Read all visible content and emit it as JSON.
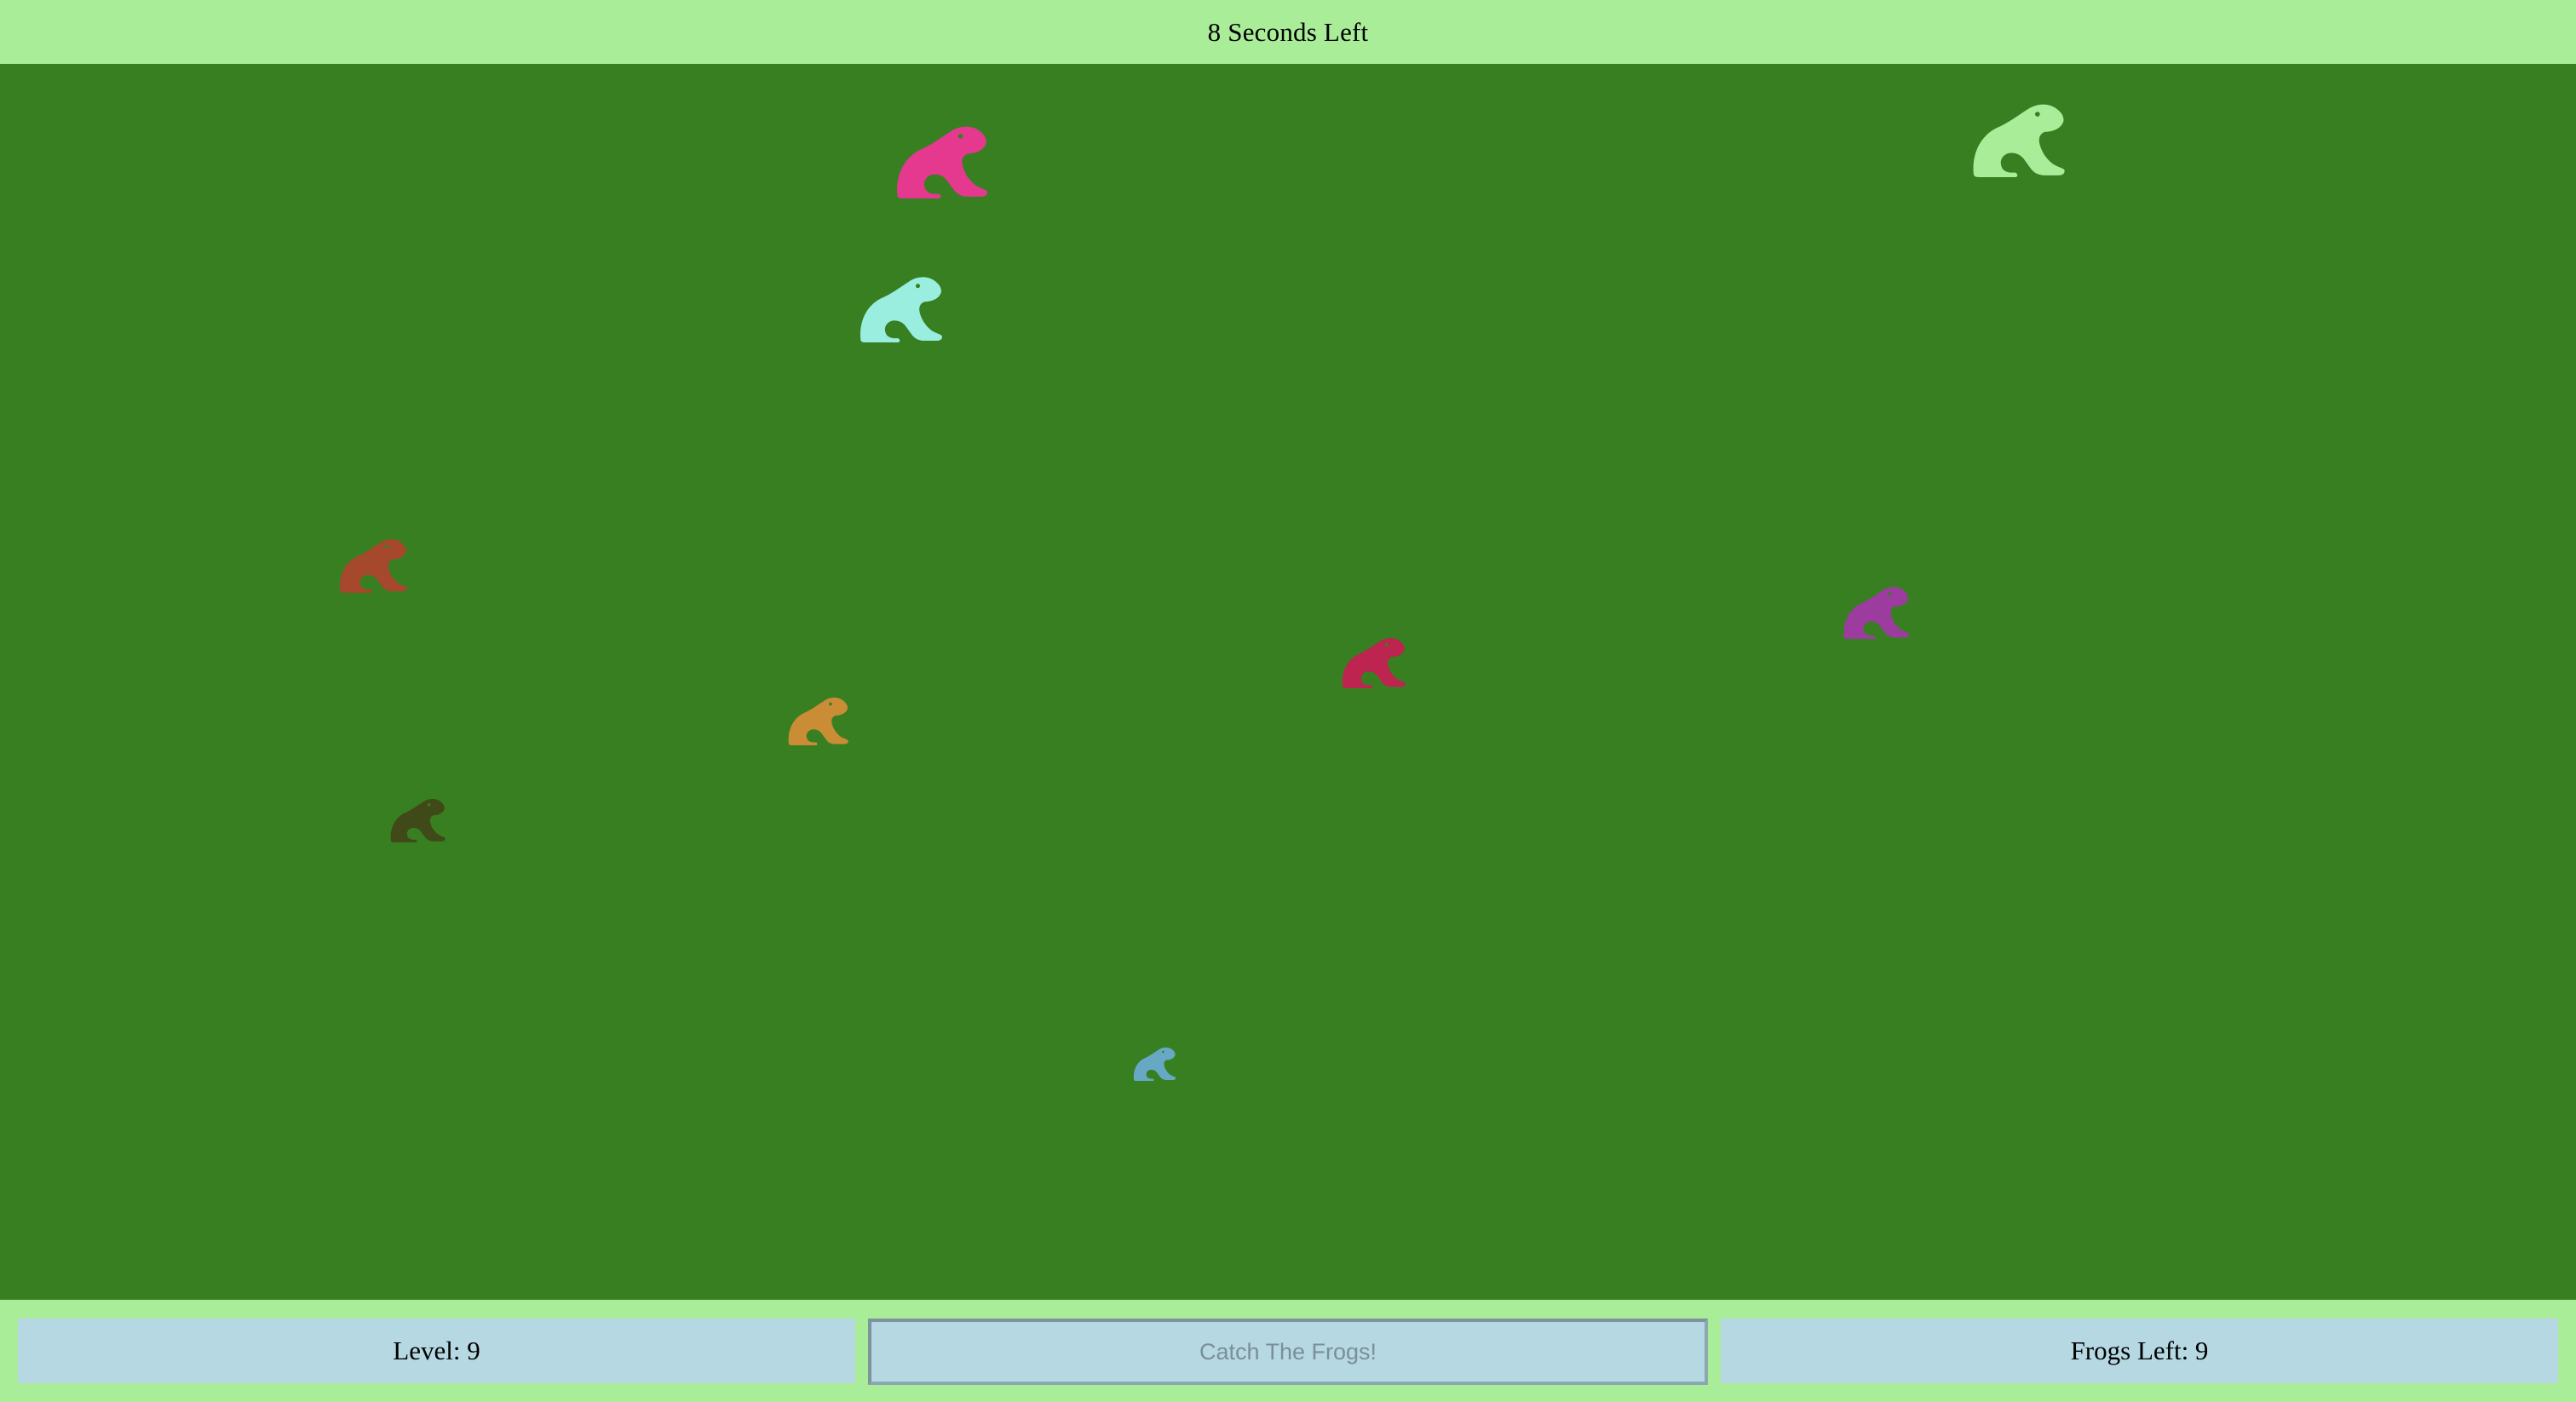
{
  "header": {
    "timer_text": "8 Seconds Left"
  },
  "footer": {
    "level_text": "Level: 9",
    "start_button_label": "Catch The Frogs!",
    "frogs_left_text": "Frogs Left: 9"
  },
  "colors": {
    "bar_background": "#aaed99",
    "field_background": "#387f22",
    "panel_background": "#b5d8e3"
  },
  "frogs": [
    {
      "name": "frog-pink",
      "color": "#e5398f",
      "icon": "frog-icon"
    },
    {
      "name": "frog-light-green",
      "color": "#aaed99",
      "icon": "frog-icon"
    },
    {
      "name": "frog-aqua",
      "color": "#9aeee0",
      "icon": "frog-icon"
    },
    {
      "name": "frog-rust",
      "color": "#a6482c",
      "icon": "frog-icon"
    },
    {
      "name": "frog-purple",
      "color": "#9b3c9e",
      "icon": "frog-icon"
    },
    {
      "name": "frog-crimson",
      "color": "#bd2450",
      "icon": "frog-icon"
    },
    {
      "name": "frog-orange",
      "color": "#cb8c36",
      "icon": "frog-icon"
    },
    {
      "name": "frog-olive",
      "color": "#3f4a18",
      "icon": "frog-icon"
    },
    {
      "name": "frog-steel-blue",
      "color": "#67a9c4",
      "icon": "frog-icon"
    }
  ]
}
